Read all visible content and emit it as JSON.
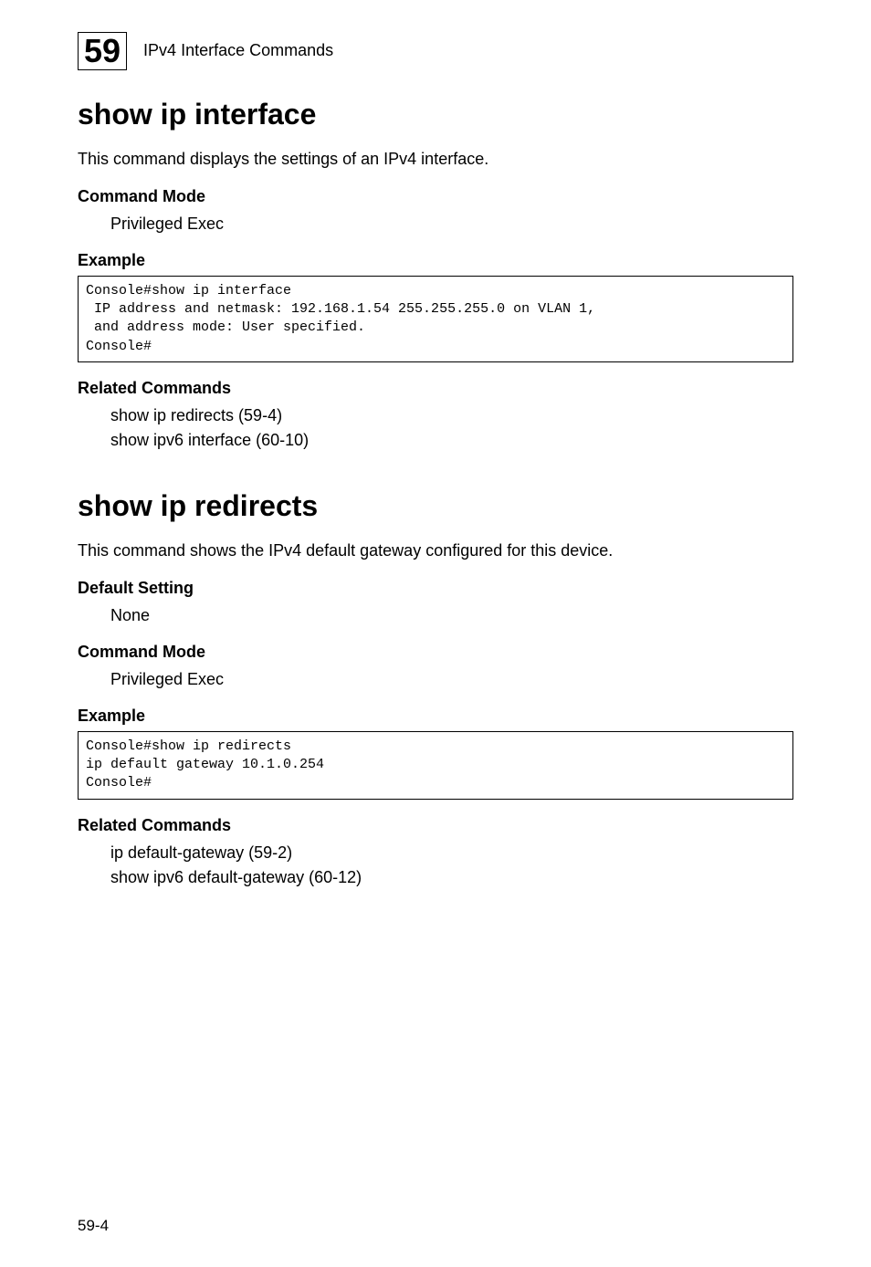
{
  "header": {
    "chapter_number": "59",
    "chapter_title": "IPv4 Interface Commands"
  },
  "section1": {
    "title": "show ip interface",
    "intro": "This command displays the settings of an IPv4 interface.",
    "command_mode": {
      "label": "Command Mode",
      "value": "Privileged Exec"
    },
    "example": {
      "label": "Example",
      "code": "Console#show ip interface\n IP address and netmask: 192.168.1.54 255.255.255.0 on VLAN 1,\n and address mode: User specified.\nConsole#"
    },
    "related": {
      "label": "Related Commands",
      "line1": "show ip redirects (59-4)",
      "line2": "show ipv6 interface (60-10)"
    }
  },
  "section2": {
    "title": "show ip redirects",
    "intro": "This command shows the IPv4 default gateway configured for this device.",
    "default_setting": {
      "label": "Default Setting",
      "value": "None"
    },
    "command_mode": {
      "label": "Command Mode",
      "value": "Privileged Exec"
    },
    "example": {
      "label": "Example",
      "code": "Console#show ip redirects\nip default gateway 10.1.0.254\nConsole#"
    },
    "related": {
      "label": "Related Commands",
      "line1": "ip default-gateway (59-2)",
      "line2": "show ipv6 default-gateway (60-12)"
    }
  },
  "page_number": "59-4"
}
